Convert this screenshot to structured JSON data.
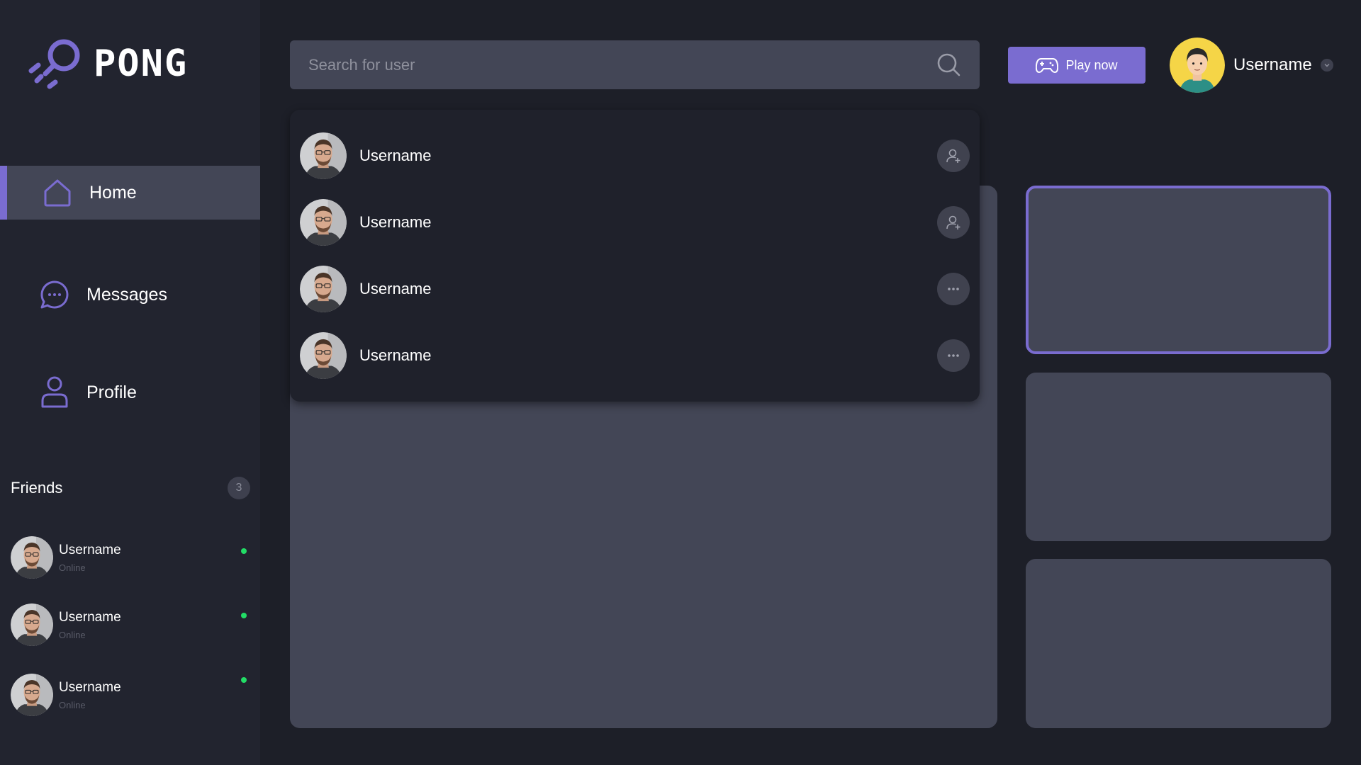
{
  "app": {
    "logo_text": "PONG"
  },
  "sidebar": {
    "nav": [
      {
        "label": "Home",
        "icon": "home-icon",
        "active": true
      },
      {
        "label": "Messages",
        "icon": "chat-icon",
        "active": false
      },
      {
        "label": "Profile",
        "icon": "user-icon",
        "active": false
      }
    ],
    "friends": {
      "title": "Friends",
      "count": "3",
      "items": [
        {
          "name": "Username",
          "status": "Online"
        },
        {
          "name": "Username",
          "status": "Online"
        },
        {
          "name": "Username",
          "status": "Online"
        }
      ]
    }
  },
  "header": {
    "search": {
      "placeholder": "Search for user",
      "value": ""
    },
    "play_label": "Play now",
    "user_name": "Username"
  },
  "search_results": [
    {
      "name": "Username",
      "action": "add-friend-icon"
    },
    {
      "name": "Username",
      "action": "add-friend-icon"
    },
    {
      "name": "Username",
      "action": "more-icon"
    },
    {
      "name": "Username",
      "action": "more-icon"
    }
  ],
  "colors": {
    "accent": "#7a6cd0",
    "background": "#1d1f28",
    "sidebar": "#22242f",
    "panel": "#434656",
    "online": "#22dd66"
  }
}
